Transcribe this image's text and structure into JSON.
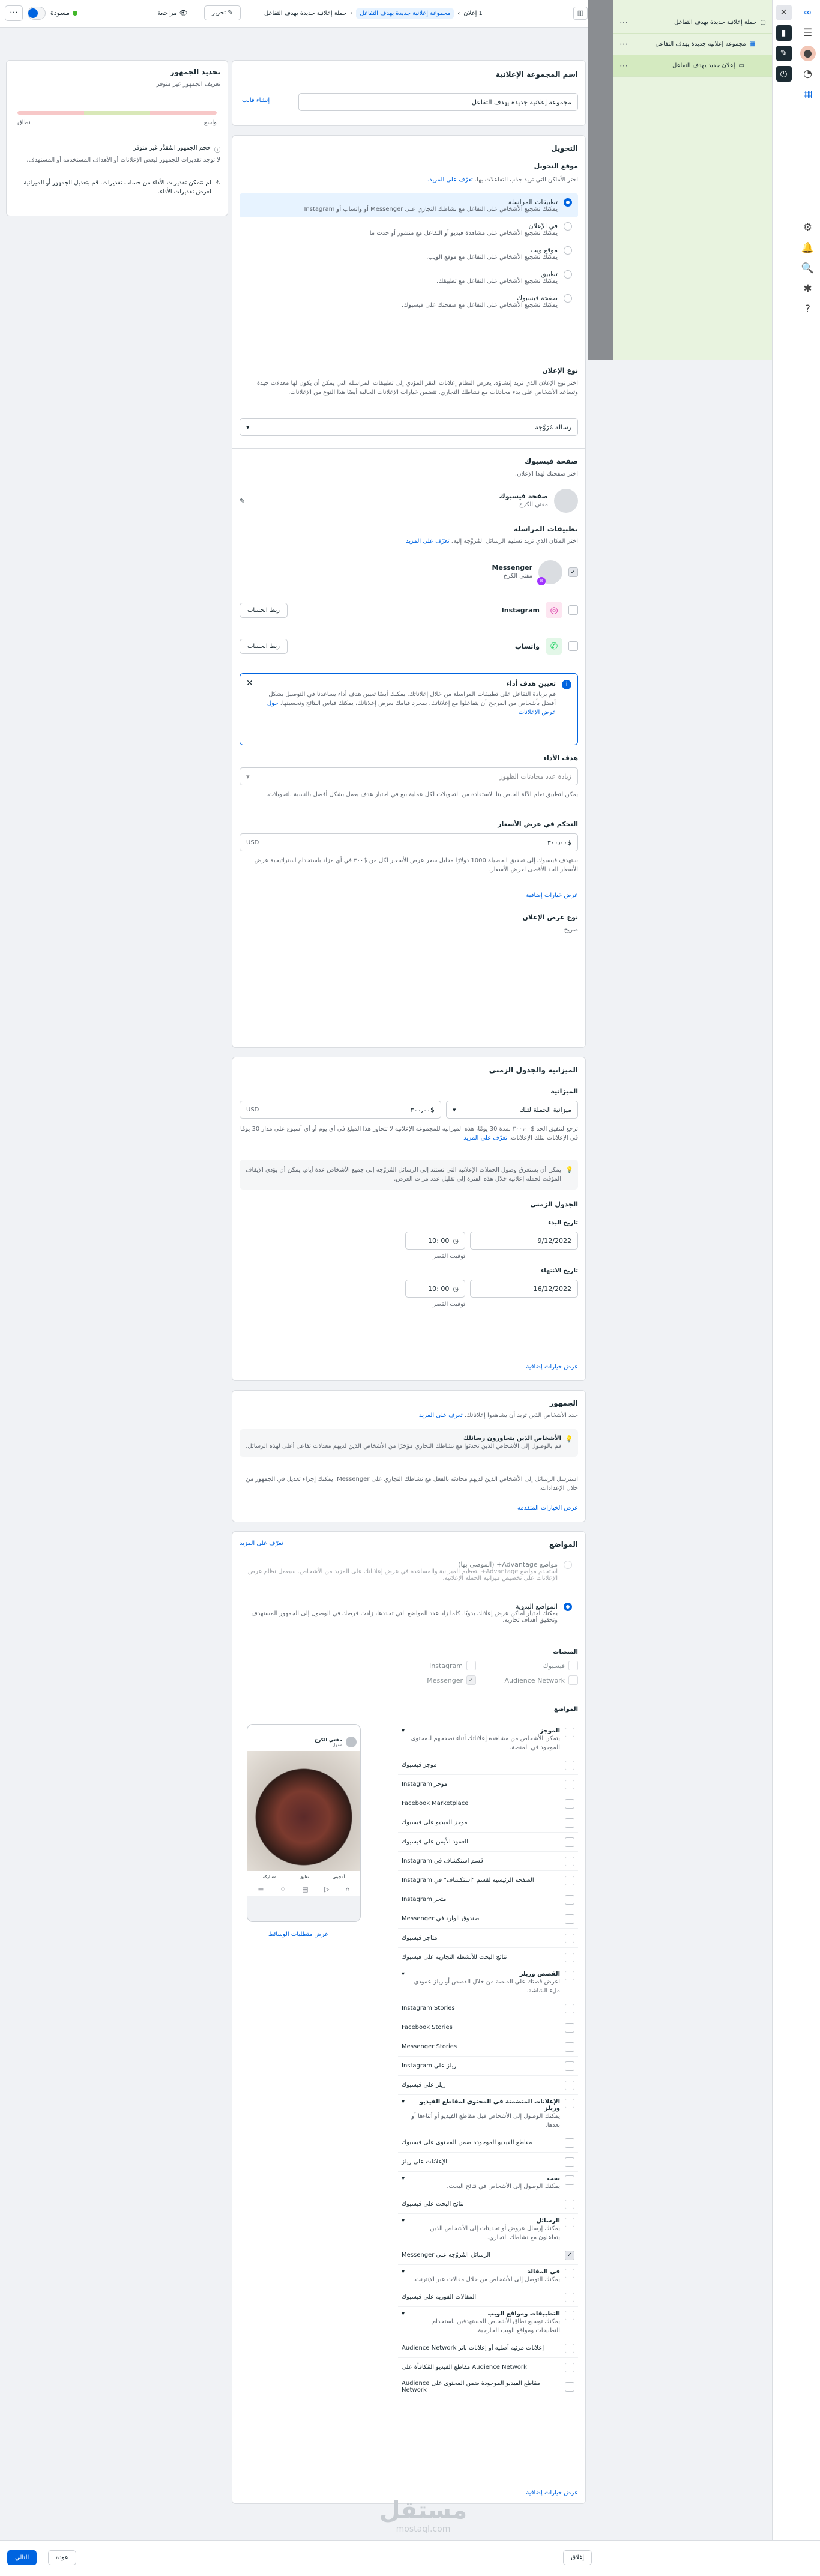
{
  "topbar": {
    "status": "مسودة",
    "edit": "تحرير",
    "review": "مراجعة",
    "crumb1": "حملة إعلانية جديدة يهدف التفاعل",
    "crumb2": "مجموعة إعلانية جديدة يهدف التفاعل",
    "crumb3": "1 إعلان"
  },
  "tree": {
    "campaign": "حملة إعلانية جديدة يهدف التفاعل",
    "adset": "مجموعة إعلانية جديدة يهدف التفاعل",
    "ad": "إعلان جديد يهدف التفاعل"
  },
  "colors": {
    "accent": "#0064e0",
    "tree_bg": "#e8f3df"
  },
  "name_card": {
    "title": "اسم المجموعة الإعلانية",
    "value": "مجموعة إعلانية جديدة يهدف التفاعل",
    "create_template": "إنشاء قالب"
  },
  "conversion": {
    "title": "التحويل",
    "location_title": "موقع التحويل",
    "location_desc": "اختر الأماكن التي تريد جذب التفاعلات بها.",
    "learn_more": "تعرّف على المزيد.",
    "options": [
      {
        "title": "تطبيقات المراسلة",
        "desc": "يمكنك تشجيع الأشخاص على التفاعل مع نشاطك التجاري على Messenger أو واتساب أو Instagram",
        "selected": true
      },
      {
        "title": "في الإعلان",
        "desc": "يمكنك تشجيع الأشخاص على مشاهدة فيديو أو التفاعل مع منشور أو حدث ما",
        "selected": false
      },
      {
        "title": "موقع ويب",
        "desc": "يمكنك تشجيع الأشخاص على التفاعل مع موقع الويب.",
        "selected": false
      },
      {
        "title": "تطبيق",
        "desc": "يمكنك تشجيع الأشخاص على التفاعل مع تطبيقك.",
        "selected": false
      },
      {
        "title": "صفحة فيسبوك",
        "desc": "يمكنك تشجيع الأشخاص على التفاعل مع صفحتك على فيسبوك.",
        "selected": false
      }
    ],
    "adtype_title": "نوع الإعلان",
    "adtype_desc": "اختر نوع الإعلان الذي تريد إنشاؤه. يعرض النظام إعلانات النقر المؤدي إلى تطبيقات المراسلة التي يمكن أن يكون لها معدلات جيدة وتساعد الأشخاص على بدء محادثات مع نشاطك التجاري. تتضمن خيارات الإعلانات الحالية أيضًا هذا النوع من الإعلانات.",
    "adtype_value": "رسالة مُرَوَّجة",
    "page_title": "صفحة فيسبوك",
    "page_desc": "اختر صفحتك لهذا الإعلان.",
    "page_name": "صفحة فيسبوك",
    "page_sub": "مفتي الكرخ",
    "apps_title": "تطبيقات المراسلة",
    "apps_desc": "اختر المكان الذي تريد تسليم الرسائل المُرَوَّجة إليه.",
    "apps_learn": "تعرّف على المزيد",
    "apps": [
      {
        "name": "Messenger",
        "sub": "مفتي الكرخ",
        "action": "",
        "checked": true
      },
      {
        "name": "Instagram",
        "sub": "",
        "action": "ربط الحساب",
        "checked": false
      },
      {
        "name": "واتساب",
        "sub": "",
        "action": "ربط الحساب",
        "checked": false
      }
    ],
    "tip_title": "تعيين هدف أداء",
    "tip_body": "قم بزيادة التفاعل على تطبيقات المراسلة من خلال إعلاناتك. يمكنك أيضًا تعيين هدف أداء يساعدنا في التوصيل بشكل أفضل بأشخاص من المرجح أن يتفاعلوا مع إعلاناتك. بمجرد قيامك بعرض إعلاناتك، يمكنك قياس النتائج وتحسينها.",
    "tip_link": "حول عرض الإعلانات",
    "goal_title": "هدف الأداء",
    "goal_placeholder": "زيادة عدد محادثات الظهور",
    "goal_desc": "يمكن لتطبيق تعلم الآلة الخاص بنا الاستفادة من التحويلات لكل عملية بيع في اختيار هدف يعمل بشكل أفضل بالنسبة للتحويلات.",
    "cost_title": "التحكم في عرض الأسعار",
    "cost_value": "$٣٠٠٫٠٠",
    "cost_currency": "USD",
    "cost_desc": "ستهدف فيسبوك إلى تحقيق الحصيلة 1000 دولارًا مقابل سعر عرض الأسعار لكل من $٣٠٠ في أي مزاد باستخدام استراتيجية عرض الأسعار الحد الأقصى لعرض الأسعار.",
    "more": "عرض خيارات إضافية",
    "bidtype_title": "نوع عرض الإعلان",
    "bidtype_value": "صريح"
  },
  "budget": {
    "title": "الميزانية والجدول الزمني",
    "budget_label": "الميزانية",
    "type": "ميزانية الحملة لتلك",
    "amount": "$٣٠٠٫٠٠",
    "currency": "USD",
    "desc": "ترجع لتنفيق الحد $٣٠٠٫٠٠ لمدة 30 يومًا، هذه الميزانية للمجموعة الإعلانية لا تتجاوز هذا المبلغ في أي يوم أو أي أسبوع على مدار 30 يومًا في الإعلانات لتلك الإعلانات.",
    "learn": "تعرّف على المزيد",
    "note": "يمكن أن يستغرق وصول الحملات الإعلانية التي تستند إلى الرسائل المُرَوَّجة إلى جميع الأشخاص عدة أيام. يمكن أن يؤدي الإيقاف المؤقت لحملة إعلانية خلال هذه الفترة إلى تقليل عدد مرات العرض.",
    "schedule": "الجدول الزمني",
    "start_label": "تاريخ البدء",
    "start_date": "9/12/2022",
    "start_time": "00 :10",
    "end_label": "تاريخ الانتهاء",
    "end_date": "16/12/2022",
    "end_time": "00 :10",
    "tz": "توقيت القصر",
    "more": "عرض خيارات إضافية"
  },
  "audience": {
    "title": "الجمهور",
    "desc": "حدد الأشخاص الذين تريد أن يشاهدوا إعلاناتك.",
    "learn": "تعرف على المزيد",
    "box_title": "الأشخاص الذين يتحاورون رسائلك",
    "box_desc": "قم بالوصول إلى الأشخاص الذين تحدثوا مع نشاطك التجاري مؤخرًا من الأشخاص الذين لديهم معدلات تفاعل أعلى لهذه الرسائل.",
    "note": "استرسل الرسائل إلى الأشخاص الذين لديهم محادثة بالفعل مع نشاطك التجاري على Messenger. يمكنك إجراء تعديل في الجمهور من خلال الإعدادات.",
    "more": "عرض الخيارات المتقدمة"
  },
  "placements": {
    "title": "المواضع",
    "learn": "تعرّف على المزيد",
    "adv_title": "مواضع Advantage+ (الموصى بها)",
    "adv_desc": "استخدم مواضع Advantage+ لتعظيم الميزانية والمساعدة في عرض إعلاناتك على المزيد من الأشخاص. سيعمل نظام عرض الإعلانات على تخصيص ميزانية الحملة الإعلانية.",
    "manual_title": "المواضع اليدوية",
    "manual_desc": "يمكنك اختيار أماكن عرض إعلانك يدويًا. كلما زاد عدد المواضع التي تحددها، زادت فرصك في الوصول إلى الجمهور المستهدف وتحقيق أهداف تجارية.",
    "platforms_title": "المنصات",
    "platforms": [
      {
        "name": "فيسبوك",
        "checked": false
      },
      {
        "name": "Instagram",
        "checked": false
      },
      {
        "name": "Audience Network",
        "checked": false
      },
      {
        "name": "Messenger",
        "checked": true
      }
    ],
    "placements_title": "المواضع",
    "preview_link": "عرض متطلبات الوسائط",
    "more": "عرض خيارات إضافية",
    "preview": {
      "name": "مفتي الكرخ",
      "sponsored": "ممول",
      "actions": [
        "أعجبني",
        "تعليق",
        "مشاركة"
      ]
    },
    "groups": [
      {
        "title": "الموجز",
        "desc": "يتمكن الأشخاص من مشاهدة إعلاناتك أثناء تصفحهم للمحتوى الموجود في المنصة.",
        "items": [
          "موجز فيسبوك",
          "موجز Instagram",
          "Facebook Marketplace",
          "موجز الفيديو على فيسبوك",
          "العمود الأيمن على فيسبوك",
          "قسم استكشاف في Instagram",
          "الصفحة الرئيسية لقسم \"استكشاف\" في Instagram",
          "متجر Instagram",
          "صندوق الوارد في Messenger",
          "متاجر فيسبوك",
          "نتائج البحث للأنشطة التجارية على فيسبوك"
        ]
      },
      {
        "title": "القصص وريلز",
        "desc": "اعرض قصتك على المنصة من خلال القصص أو ريلز عمودي ملء الشاشة.",
        "items": [
          "Instagram Stories",
          "Facebook Stories",
          "Messenger Stories",
          "ريلز على Instagram",
          "ريلز على فيسبوك"
        ]
      },
      {
        "title": "الإعلانات المتضمنة في المحتوى لمقاطع الفيديو وريلز",
        "desc": "يمكنك الوصول إلى الأشخاص قبل مقاطع الفيديو أو أثناءها أو بعدها.",
        "items": [
          "مقاطع الفيديو الموجودة ضمن المحتوى على فيسبوك",
          "الإعلانات على ريلز"
        ]
      },
      {
        "title": "بحث",
        "desc": "يمكنك الوصول إلى الأشخاص في نتائج البحث.",
        "items": [
          "نتائج البحث على فيسبوك"
        ]
      },
      {
        "title": "الرسائل",
        "desc": "يمكنك إرسال عروض أو تحديثات إلى الأشخاص الذين يتفاعلون مع نشاطك التجاري.",
        "items": [
          "الرسائل المُرَوَّجة على Messenger"
        ]
      },
      {
        "title": "في المقالة",
        "desc": "يمكنك التوصل إلى الأشخاص من خلال مقالات عبر الإنترنت.",
        "items": [
          "المقالات الفورية على فيسبوك"
        ]
      },
      {
        "title": "التطبيقات ومواقع الويب",
        "desc": "يمكنك توسيع نطاق الأشخاص المستهدفين باستخدام التطبيقات ومواقع الويب الخارجية.",
        "items": [
          "إعلانات مرئية أصلية أو إعلانات بانر Audience Network",
          "Audience Network مقاطع الفيديو المُكافأة على",
          "مقاطع الفيديو الموجودة ضمن المحتوى على Audience Network"
        ]
      }
    ]
  },
  "audience_def": {
    "title": "تحديد الجمهور",
    "subtitle": "تعريف الجمهور غير متوفر",
    "left_label": "نطاق",
    "right_label": "واسع",
    "meter_note": "حجم الجمهور المُقدَّر غير متوفر",
    "detail": "لا توجد تقديرات للجمهور لبعض الإعلانات أو الأهداف المستخدمة أو المستهدف.",
    "warn": "لم تتمكن تقديرات الأداء من حساب تقديرات. قم بتعديل الجمهور أو الميزانية لعرض تقديرات الأداء."
  },
  "bottom": {
    "close": "إغلاق",
    "back": "عودة",
    "next": "التالي"
  },
  "watermark": {
    "ar": "مستقل",
    "en": "mostaql.com"
  }
}
